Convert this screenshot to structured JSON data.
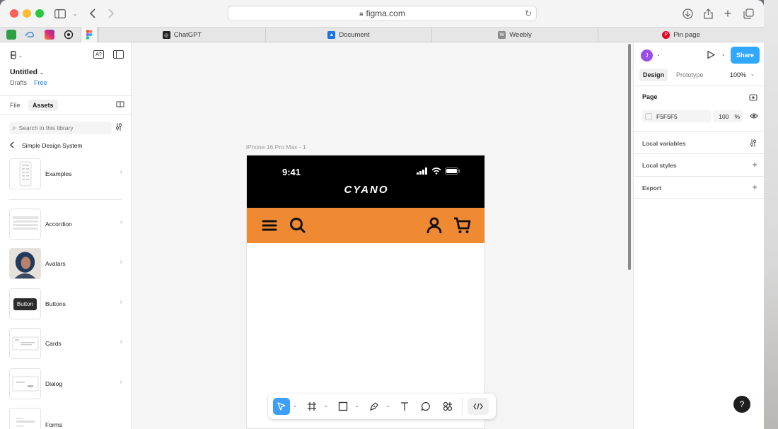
{
  "browser": {
    "url": "figma.com",
    "tabs": [
      {
        "label": "ChatGPT"
      },
      {
        "label": "Document"
      },
      {
        "label": "Weebly"
      },
      {
        "label": "Pin page"
      }
    ]
  },
  "left_panel": {
    "file_title": "Untitled",
    "drafts": "Drafts",
    "plan": "Free",
    "tab_file": "File",
    "tab_assets": "Assets",
    "search_placeholder": "Search in this library",
    "library_title": "Simple Design System",
    "assets": [
      {
        "name": "Examples"
      },
      {
        "name": "Accordion"
      },
      {
        "name": "Avatars"
      },
      {
        "name": "Buttons",
        "thumb_text": "Button"
      },
      {
        "name": "Cards"
      },
      {
        "name": "Dialog"
      },
      {
        "name": "Forms"
      }
    ]
  },
  "canvas": {
    "frame_label": "iPhone 16 Pro Max - 1",
    "phone_time": "9:41",
    "brand": "CYANO",
    "header_color": "#ef8a33"
  },
  "right_panel": {
    "avatar_initial": "J",
    "share_label": "Share",
    "tab_design": "Design",
    "tab_prototype": "Prototype",
    "zoom": "100%",
    "page_title": "Page",
    "page_color": "F5F5F5",
    "page_opacity": "100",
    "opacity_unit": "%",
    "local_variables": "Local variables",
    "local_styles": "Local styles",
    "export": "Export"
  },
  "help_label": "?"
}
